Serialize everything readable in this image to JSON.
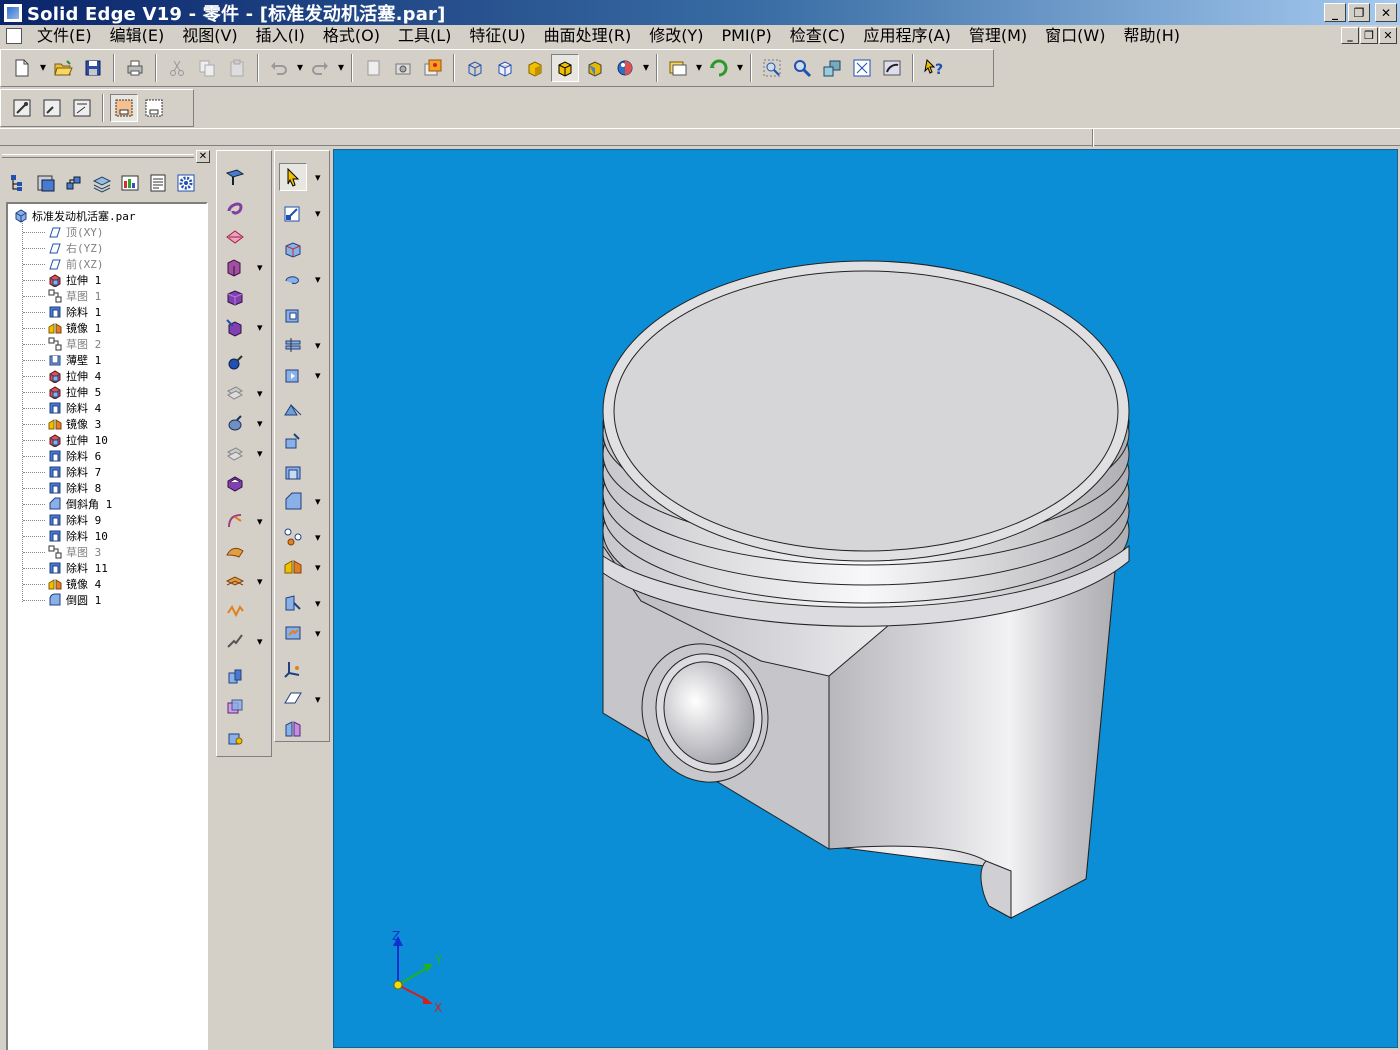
{
  "window": {
    "title": "Solid Edge V19 - 零件 - [标准发动机活塞.par]"
  },
  "menu": [
    "文件(E)",
    "编辑(E)",
    "视图(V)",
    "插入(I)",
    "格式(O)",
    "工具(L)",
    "特征(U)",
    "曲面处理(R)",
    "修改(Y)",
    "PMI(P)",
    "检查(C)",
    "应用程序(A)",
    "管理(M)",
    "窗口(W)",
    "帮助(H)"
  ],
  "tree": {
    "root": "标准发动机活塞.par",
    "items": [
      {
        "label": "顶(XY)",
        "dim": true,
        "icon": "plane-icon"
      },
      {
        "label": "右(YZ)",
        "dim": true,
        "icon": "plane-icon"
      },
      {
        "label": "前(XZ)",
        "dim": true,
        "icon": "plane-icon"
      },
      {
        "label": "拉伸 1",
        "dim": false,
        "icon": "extrude-icon"
      },
      {
        "label": "草图 1",
        "dim": true,
        "icon": "sketch-icon"
      },
      {
        "label": "除料 1",
        "dim": false,
        "icon": "cutout-icon"
      },
      {
        "label": "镜像 1",
        "dim": false,
        "icon": "mirror-icon"
      },
      {
        "label": "草图 2",
        "dim": true,
        "icon": "sketch-icon"
      },
      {
        "label": "薄壁 1",
        "dim": false,
        "icon": "thinwall-icon"
      },
      {
        "label": "拉伸 4",
        "dim": false,
        "icon": "extrude-icon"
      },
      {
        "label": "拉伸 5",
        "dim": false,
        "icon": "extrude-icon"
      },
      {
        "label": "除料 4",
        "dim": false,
        "icon": "cutout-icon"
      },
      {
        "label": "镜像 3",
        "dim": false,
        "icon": "mirror-icon"
      },
      {
        "label": "拉伸 10",
        "dim": false,
        "icon": "extrude-icon"
      },
      {
        "label": "除料 6",
        "dim": false,
        "icon": "cutout-icon"
      },
      {
        "label": "除料 7",
        "dim": false,
        "icon": "cutout-icon"
      },
      {
        "label": "除料 8",
        "dim": false,
        "icon": "cutout-icon"
      },
      {
        "label": "倒斜角 1",
        "dim": false,
        "icon": "chamfer-icon"
      },
      {
        "label": "除料 9",
        "dim": false,
        "icon": "cutout-icon"
      },
      {
        "label": "除料 10",
        "dim": false,
        "icon": "cutout-icon"
      },
      {
        "label": "草图 3",
        "dim": true,
        "icon": "sketch-icon"
      },
      {
        "label": "除料 11",
        "dim": false,
        "icon": "cutout-icon"
      },
      {
        "label": "镜像 4",
        "dim": false,
        "icon": "mirror-icon"
      },
      {
        "label": "倒圆 1",
        "dim": false,
        "icon": "round-icon"
      }
    ]
  },
  "triad": {
    "z": "Z",
    "y": "Y",
    "x": "X"
  },
  "colors": {
    "viewport_bg": "#0b8ed6",
    "titlebar_start": "#0a246a",
    "titlebar_end": "#a6caf0",
    "part_gray": "#d6d6d6"
  }
}
